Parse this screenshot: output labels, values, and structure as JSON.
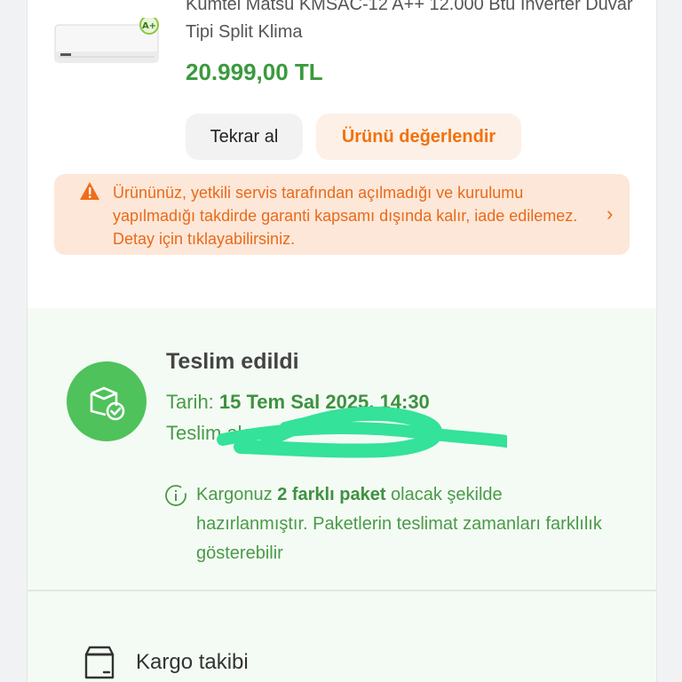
{
  "product": {
    "title": "Kumtel Matsu KMSAC-12 A++ 12.000 Btu Inverter Duvar Tipi Split Klima",
    "price": "20.999,00 TL",
    "image_badge": "A+"
  },
  "actions": {
    "reorder_label": "Tekrar al",
    "review_label": "Ürünü değerlendir"
  },
  "warning": {
    "text": "Ürününüz, yetkili servis tarafından açılmadığı ve kurulumu yapılmadığı takdirde garanti kapsamı dışında kalır, iade edilemez. Detay için tıklayabilirsiniz."
  },
  "delivery": {
    "status": "Teslim edildi",
    "date_label": "Tarih:",
    "date_value": "15 Tem Sal 2025, 14:30",
    "recipient_prefix": "Teslim alan",
    "info_pre": "Kargonuz",
    "info_bold": "2 farklı paket",
    "info_post": "olacak şekilde hazırlanmıştır. Paketlerin teslimat zamanları farklılık gösterebilir"
  },
  "tracking": {
    "label": "Kargo takibi"
  },
  "colors": {
    "accent_green": "#4fc25c",
    "text_green": "#4a9a48",
    "orange": "#f0720f",
    "warning_bg": "#fde7d8",
    "redaction": "#34e29a"
  },
  "icons": {
    "warning": "warning-triangle-icon",
    "chevron": "chevron-right-icon",
    "status": "package-check-icon",
    "info": "info-icon",
    "tracking": "box-icon"
  }
}
